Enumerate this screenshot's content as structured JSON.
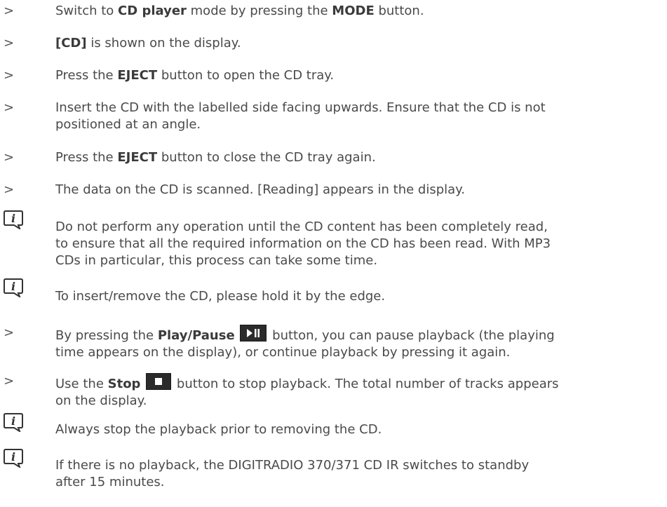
{
  "marker": ">",
  "items": [
    {
      "type": "step",
      "pre": "Switch to ",
      "b1": "CD player",
      "mid": " mode by pressing the ",
      "b2": "MODE",
      "post": " button."
    },
    {
      "type": "step",
      "b1": "[CD]",
      "post": " is shown on the display."
    },
    {
      "type": "step",
      "pre": "Press the ",
      "b1": "EJECT",
      "post": " button to open the CD tray."
    },
    {
      "type": "step",
      "line1": "Insert the CD with the labelled side facing upwards. Ensure that the CD is not",
      "line2": "positioned at an angle."
    },
    {
      "type": "step",
      "pre": "Press the ",
      "b1": "EJECT",
      "post": " button to close the CD tray again."
    },
    {
      "type": "step",
      "text": "The data on the CD is scanned. [Reading] appears in the display."
    },
    {
      "type": "info",
      "line1": "Do not perform any operation until the CD content has been completely read,",
      "line2": "to ensure that all the required information on the CD has been read. With MP3",
      "line3": "CDs in particular, this process can take some time."
    },
    {
      "type": "info",
      "text": "To insert/remove the CD, please hold it by the edge."
    },
    {
      "type": "step",
      "pre": "By pressing the ",
      "b1": "Play/Pause",
      "post": " button, you can pause playback (the playing",
      "line2": "time appears on the display), or continue playback by pressing it again."
    },
    {
      "type": "step",
      "pre": "Use the ",
      "b1": "Stop",
      "post": " button to stop playback. The total number of tracks appears",
      "line2": "on the display."
    },
    {
      "type": "info",
      "text": "Always stop the playback prior to removing the CD."
    },
    {
      "type": "info",
      "line1": "If there is no playback, the DIGITRADIO 370/371 CD IR switches to standby",
      "line2": "after 15 minutes."
    }
  ],
  "icons": {
    "info": "info-note-icon",
    "play_pause": "play-pause-icon",
    "stop": "stop-icon"
  },
  "colors": {
    "text": "#4a4a4a",
    "button_bg": "#2b2b2b"
  }
}
